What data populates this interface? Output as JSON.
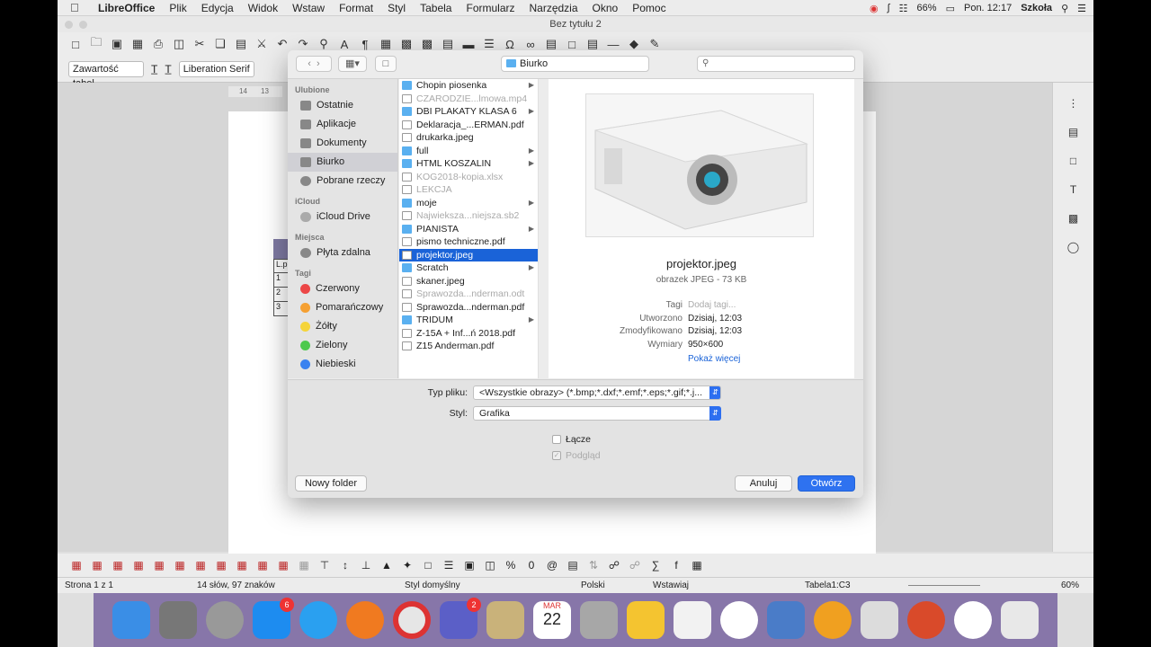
{
  "menubar": {
    "app": "LibreOffice",
    "items": [
      "Plik",
      "Edycja",
      "Widok",
      "Wstaw",
      "Format",
      "Styl",
      "Tabela",
      "Formularz",
      "Narzędzia",
      "Okno",
      "Pomoc"
    ],
    "battery": "66%",
    "clock": "Pon. 12:17",
    "user": "Szkoła"
  },
  "window": {
    "title": "Bez tytułu 2"
  },
  "toolbar": {
    "style_combo": "Zawartość tabel",
    "font_combo": "Liberation Serif"
  },
  "document": {
    "ruler_marks": [
      "14",
      "13"
    ],
    "table_header": "L.p",
    "table_rows": [
      "1",
      "2",
      "3"
    ]
  },
  "statusbar": {
    "page": "Strona 1 z 1",
    "words": "14 słów, 97 znaków",
    "style": "Styl domyślny",
    "language": "Polski",
    "mode": "Wstawiaj",
    "cell": "Tabela1:C3",
    "zoom": "60%"
  },
  "dock": {
    "appstore_badge": "6",
    "teams_badge": "2",
    "calendar_month": "MAR",
    "calendar_day": "22"
  },
  "dialog": {
    "location": "Biurko",
    "sidebar": {
      "favorites_header": "Ulubione",
      "favorites": [
        "Ostatnie",
        "Aplikacje",
        "Dokumenty",
        "Biurko",
        "Pobrane rzeczy"
      ],
      "icloud_header": "iCloud",
      "icloud": [
        "iCloud Drive"
      ],
      "places_header": "Miejsca",
      "places": [
        "Płyta zdalna"
      ],
      "tags_header": "Tagi",
      "tags": [
        {
          "label": "Czerwony",
          "color": "#ec4747"
        },
        {
          "label": "Pomarańczowy",
          "color": "#f5a032"
        },
        {
          "label": "Żółty",
          "color": "#f5d43a"
        },
        {
          "label": "Zielony",
          "color": "#4cc94c"
        },
        {
          "label": "Niebieski",
          "color": "#3a82f0"
        }
      ]
    },
    "files": [
      {
        "name": "Chopin piosenka",
        "type": "folder",
        "dim": false,
        "arrow": true
      },
      {
        "name": "CZARODZIE...lmowa.mp4",
        "type": "doc",
        "dim": true,
        "arrow": false
      },
      {
        "name": "DBI PLAKATY KLASA 6",
        "type": "folder",
        "dim": false,
        "arrow": true
      },
      {
        "name": "Deklaracja_...ERMAN.pdf",
        "type": "doc",
        "dim": false,
        "arrow": false
      },
      {
        "name": "drukarka.jpeg",
        "type": "doc",
        "dim": false,
        "arrow": false
      },
      {
        "name": "full",
        "type": "folder",
        "dim": false,
        "arrow": true
      },
      {
        "name": "HTML KOSZALIN",
        "type": "folder",
        "dim": false,
        "arrow": true
      },
      {
        "name": "KOG2018-kopia.xlsx",
        "type": "doc",
        "dim": true,
        "arrow": false
      },
      {
        "name": "LEKCJA",
        "type": "doc",
        "dim": true,
        "arrow": false
      },
      {
        "name": "moje",
        "type": "folder",
        "dim": false,
        "arrow": true
      },
      {
        "name": "Najwieksza...niejsza.sb2",
        "type": "doc",
        "dim": true,
        "arrow": false
      },
      {
        "name": "PIANISTA",
        "type": "folder",
        "dim": false,
        "arrow": true
      },
      {
        "name": "pismo techniczne.pdf",
        "type": "doc",
        "dim": false,
        "arrow": false
      },
      {
        "name": "projektor.jpeg",
        "type": "doc",
        "dim": false,
        "arrow": false,
        "selected": true
      },
      {
        "name": "Scratch",
        "type": "folder",
        "dim": false,
        "arrow": true
      },
      {
        "name": "skaner.jpeg",
        "type": "doc",
        "dim": false,
        "arrow": false
      },
      {
        "name": "Sprawozda...nderman.odt",
        "type": "doc",
        "dim": true,
        "arrow": false
      },
      {
        "name": "Sprawozda...nderman.pdf",
        "type": "doc",
        "dim": false,
        "arrow": false
      },
      {
        "name": "TRIDUM",
        "type": "folder",
        "dim": false,
        "arrow": true
      },
      {
        "name": "Z-15A + Inf...ń 2018.pdf",
        "type": "doc",
        "dim": false,
        "arrow": false
      },
      {
        "name": "Z15 Anderman.pdf",
        "type": "doc",
        "dim": false,
        "arrow": false
      }
    ],
    "preview": {
      "filename": "projektor.jpeg",
      "kind": "obrazek JPEG - 73 KB",
      "tags_label": "Tagi",
      "tags_value": "Dodaj tagi...",
      "created_label": "Utworzono",
      "created_value": "Dzisiaj, 12:03",
      "modified_label": "Zmodyfikowano",
      "modified_value": "Dzisiaj, 12:03",
      "dims_label": "Wymiary",
      "dims_value": "950×600",
      "more": "Pokaż więcej"
    },
    "filetype_label": "Typ pliku:",
    "filetype_value": "<Wszystkie obrazy> (*.bmp;*.dxf;*.emf;*.eps;*.gif;*.j...",
    "style_label": "Styl:",
    "style_value": "Grafika",
    "link_label": "Łącze",
    "preview_label": "Podgląd",
    "new_folder": "Nowy folder",
    "cancel": "Anuluj",
    "open": "Otwórz"
  }
}
